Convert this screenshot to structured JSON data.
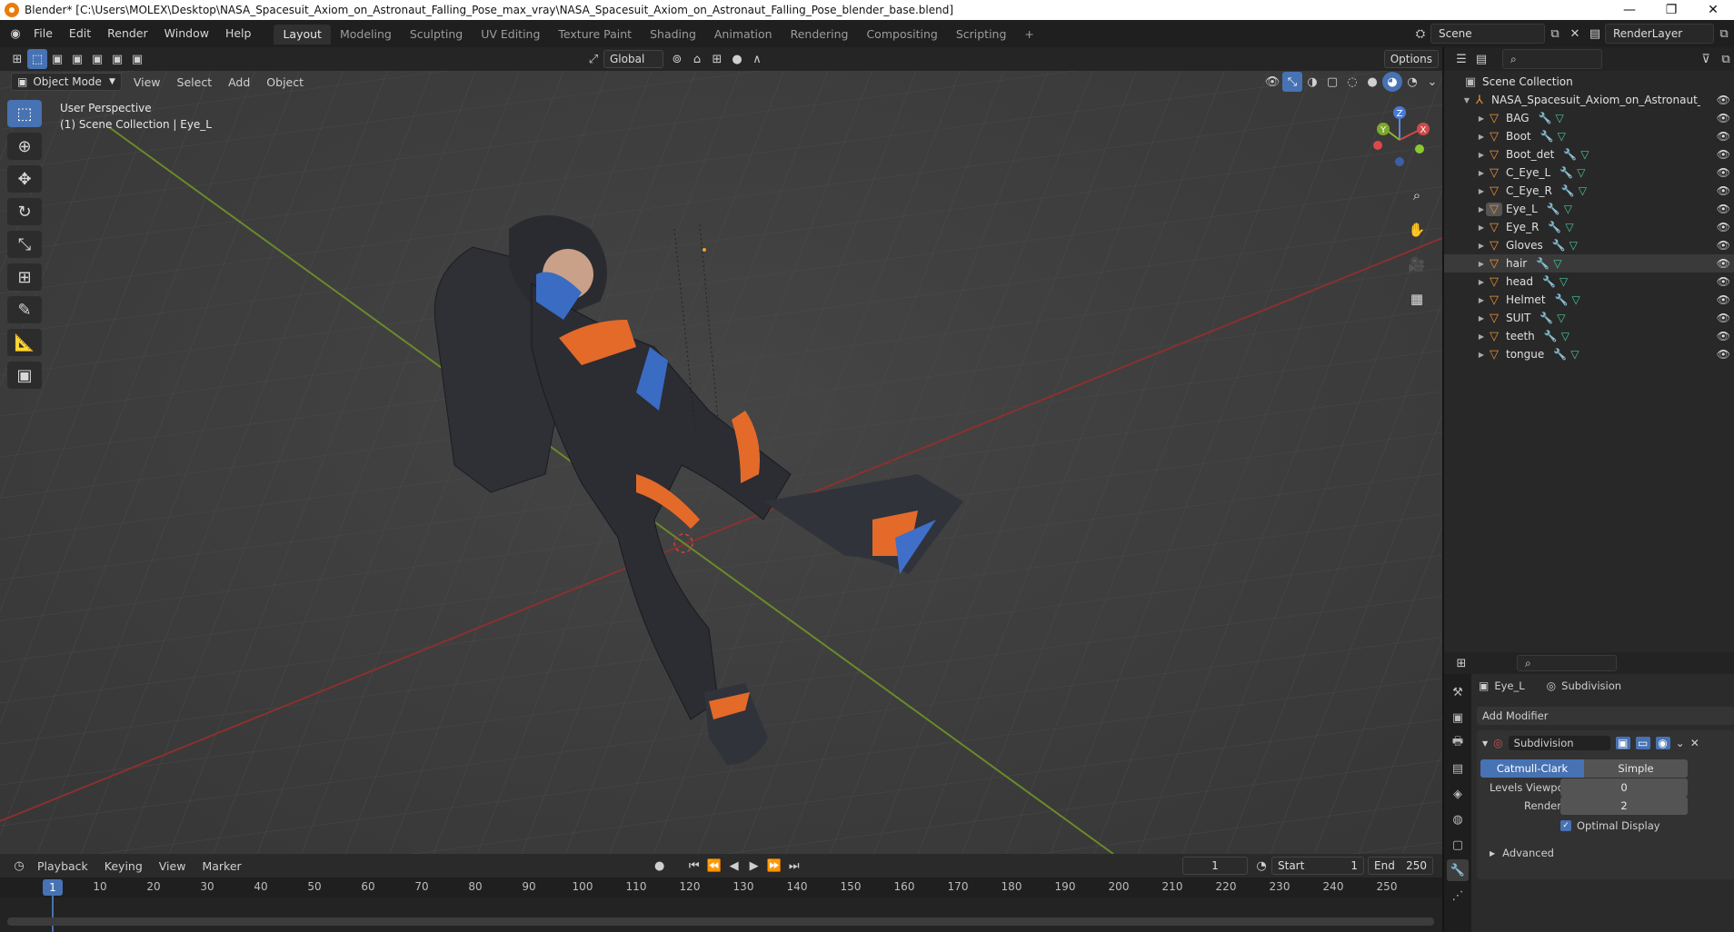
{
  "window": {
    "title": "Blender* [C:\\Users\\MOLEX\\Desktop\\NASA_Spacesuit_Axiom_on_Astronaut_Falling_Pose_max_vray\\NASA_Spacesuit_Axiom_on_Astronaut_Falling_Pose_blender_base.blend]",
    "minimize": "—",
    "maximize": "❐",
    "close": "✕"
  },
  "menu": {
    "items": [
      "File",
      "Edit",
      "Render",
      "Window",
      "Help"
    ],
    "workspaces": [
      "Layout",
      "Modeling",
      "Sculpting",
      "UV Editing",
      "Texture Paint",
      "Shading",
      "Animation",
      "Rendering",
      "Compositing",
      "Scripting"
    ],
    "add_workspace": "+",
    "scene": "Scene",
    "view_layer": "RenderLayer"
  },
  "viewport": {
    "transform_orientation": "Global",
    "options": "Options",
    "mode": "Object Mode",
    "header_menus": [
      "View",
      "Select",
      "Add",
      "Object"
    ],
    "perspective_label": "User Perspective",
    "collection_label": "(1) Scene Collection | Eye_L",
    "gizmo": {
      "x": "X",
      "y": "Y",
      "z": "Z"
    }
  },
  "timeline": {
    "menus": [
      "Playback",
      "Keying",
      "View",
      "Marker"
    ],
    "current_frame": "1",
    "start_label": "Start",
    "start": "1",
    "end_label": "End",
    "end": "250",
    "ticks": [
      "10",
      "20",
      "30",
      "40",
      "50",
      "60",
      "70",
      "80",
      "90",
      "100",
      "110",
      "120",
      "130",
      "140",
      "150",
      "160",
      "170",
      "180",
      "190",
      "200",
      "210",
      "220",
      "230",
      "240",
      "250"
    ],
    "playhead": "1"
  },
  "outliner": {
    "root": "Scene Collection",
    "collection": "NASA_Spacesuit_Axiom_on_Astronaut_Fallir",
    "objects": [
      "BAG",
      "Boot",
      "Boot_det",
      "C_Eye_L",
      "C_Eye_R",
      "Eye_L",
      "Eye_R",
      "Gloves",
      "hair",
      "head",
      "Helmet",
      "SUIT",
      "teeth",
      "tongue"
    ]
  },
  "properties": {
    "object": "Eye_L",
    "modifier_context": "Subdivision",
    "add_modifier": "Add Modifier",
    "modifier_name": "Subdivision",
    "algo_options": [
      "Catmull-Clark",
      "Simple"
    ],
    "levels_viewport_label": "Levels Viewport",
    "levels_viewport": "0",
    "render_label": "Render",
    "render_levels": "2",
    "optimal_display": "Optimal Display",
    "advanced": "Advanced"
  }
}
